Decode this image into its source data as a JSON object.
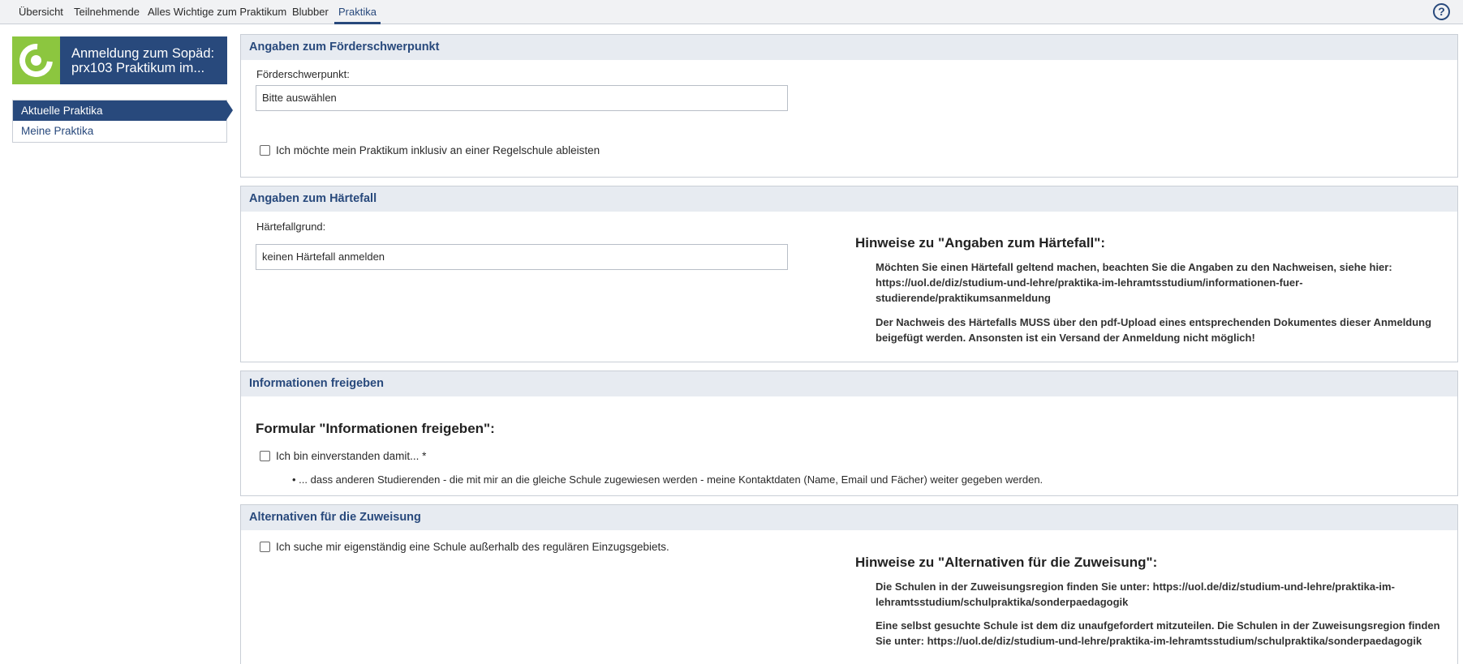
{
  "topnav": {
    "tabs": [
      {
        "label": "Übersicht"
      },
      {
        "label": "Teilnehmende"
      },
      {
        "label": "Alles Wichtige zum Praktikum"
      },
      {
        "label": "Blubber"
      },
      {
        "label": "Praktika"
      }
    ],
    "active_tab": "Praktika",
    "help_label": "?"
  },
  "course": {
    "title_line1": "Anmeldung zum Sopäd:",
    "title_line2": "prx103 Praktikum im..."
  },
  "sidenav": {
    "items": [
      {
        "label": "Aktuelle Praktika"
      },
      {
        "label": "Meine Praktika"
      }
    ]
  },
  "sections": {
    "foerder": {
      "title": "Angaben zum Förderschwerpunkt",
      "field_label": "Förderschwerpunkt:",
      "select_value": "Bitte auswählen",
      "checkbox_label": "Ich möchte mein Praktikum inklusiv an einer Regelschule ableisten"
    },
    "haerte": {
      "title": "Angaben zum Härtefall",
      "field_label": "Härtefallgrund:",
      "select_value": "keinen Härtefall anmelden",
      "hint_title": "Hinweise zu \"Angaben zum Härtefall\":",
      "hint_p1": "Möchten Sie einen Härtefall geltend machen, beachten Sie die Angaben zu den Nachweisen, siehe hier: https://uol.de/diz/studium-und-lehre/praktika-im-lehramtsstudium/informationen-fuer-studierende/praktikumsanmeldung",
      "hint_p2": "Der Nachweis des Härtefalls MUSS über den pdf-Upload eines entsprechenden Dokumentes dieser Anmeldung beigefügt werden. Ansonsten ist ein Versand der Anmeldung nicht möglich!"
    },
    "info": {
      "title": "Informationen freigeben",
      "form_title": "Formular \"Informationen freigeben\":",
      "checkbox_label": "Ich bin einverstanden damit... *",
      "bullet": "• ... dass anderen Studierenden - die mit mir an die gleiche Schule zugewiesen werden - meine Kontaktdaten (Name, Email und Fächer) weiter gegeben werden."
    },
    "alt": {
      "title": "Alternativen für die Zuweisung",
      "checkbox_label": "Ich suche mir eigenständig eine Schule außerhalb des regulären Einzugsgebiets.",
      "hint_title": "Hinweise zu \"Alternativen für die Zuweisung\":",
      "hint_p1": "Die Schulen in der Zuweisungsregion finden Sie unter: https://uol.de/diz/studium-und-lehre/praktika-im-lehramtsstudium/schulpraktika/sonderpaedagogik",
      "hint_p2": "Eine selbst gesuchte Schule ist dem diz unaufgefordert mitzuteilen. Die Schulen in der Zuweisungsregion finden Sie unter: https://uol.de/diz/studium-und-lehre/praktika-im-lehramtsstudium/schulpraktika/sonderpaedagogik"
    }
  },
  "colors": {
    "brand_blue": "#28497c",
    "logo_green": "#8cc63f",
    "section_head_bg": "#e7ebf1"
  }
}
